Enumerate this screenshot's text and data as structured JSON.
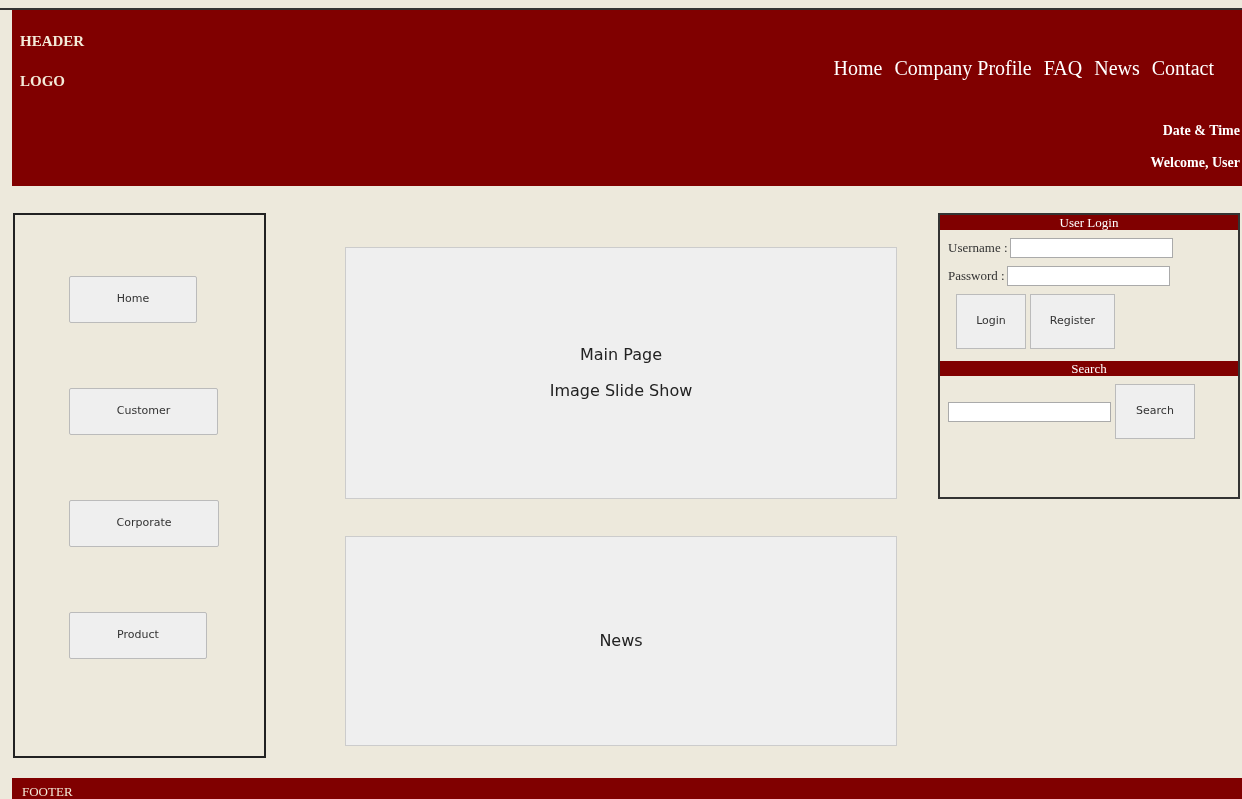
{
  "header": {
    "lines": [
      "HEADER",
      "LOGO"
    ],
    "nav": [
      "Home",
      "Company Profile",
      "FAQ",
      "News",
      "Contact"
    ],
    "info": [
      "Date & Time",
      "Welcome, User"
    ]
  },
  "sidebar": {
    "items": [
      "Home",
      "Customer",
      "Corporate",
      "Product"
    ]
  },
  "main": {
    "slideshow": [
      "Main Page",
      "Image Slide Show"
    ],
    "news": "News"
  },
  "login": {
    "title": "User Login",
    "fields": [
      {
        "label": "Username :"
      },
      {
        "label": "Password :"
      }
    ],
    "buttons": [
      "Login",
      "Register"
    ]
  },
  "search": {
    "title": "Search",
    "button": "Search"
  },
  "footer": "FOOTER"
}
